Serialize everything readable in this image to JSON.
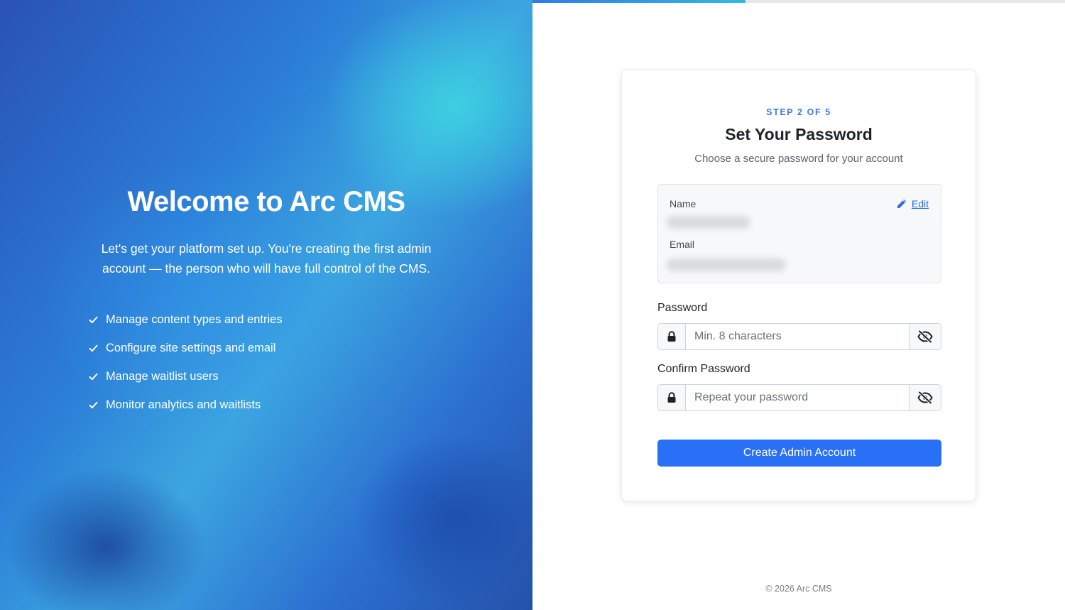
{
  "hero": {
    "title": "Welcome to Arc CMS",
    "subtitle": "Let's get your platform set up. You're creating the first admin account — the person who will have full control of the CMS.",
    "features": [
      "Manage content types and entries",
      "Configure site settings and email",
      "Manage waitlist users",
      "Monitor analytics and waitlists"
    ]
  },
  "progress": {
    "current_step": 2,
    "total_steps": 5,
    "fraction": 0.4
  },
  "card": {
    "step_label": "STEP 2 OF 5",
    "title": "Set Your Password",
    "subtitle": "Choose a secure password for your account",
    "account": {
      "name_label": "Name",
      "email_label": "Email",
      "edit_label": "Edit"
    },
    "password": {
      "label": "Password",
      "placeholder": "Min. 8 characters"
    },
    "confirm": {
      "label": "Confirm Password",
      "placeholder": "Repeat your password"
    },
    "submit_label": "Create Admin Account"
  },
  "footer": {
    "copyright": "© 2026 Arc CMS"
  },
  "colors": {
    "accent": "#2870f5",
    "step_text": "#3c7be6",
    "progress_start": "#2f7ae8",
    "progress_end": "#35b8df"
  },
  "icons": {
    "feature": "check-icon",
    "edit": "pencil-icon",
    "field": "lock-icon",
    "toggle": "eye-off-icon"
  }
}
